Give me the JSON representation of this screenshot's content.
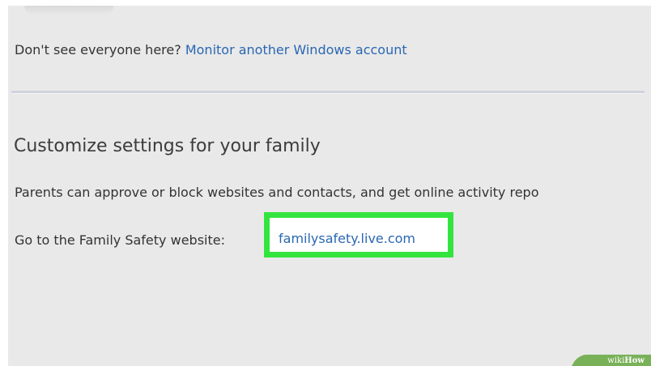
{
  "prompt": {
    "text": "Don't see everyone here?",
    "link_label": "Monitor another Windows account"
  },
  "section": {
    "heading": "Customize settings for your family",
    "description": "Parents can approve or block websites and contacts, and get online activity repo",
    "website_prefix": "Go to the Family Safety website:",
    "website_link": "familysafety.live.com"
  },
  "watermark": {
    "part1": "wiki",
    "part2": "How"
  },
  "colors": {
    "link": "#2a67b3",
    "highlight": "#33e43f",
    "panel_background": "#e9e9e9"
  }
}
